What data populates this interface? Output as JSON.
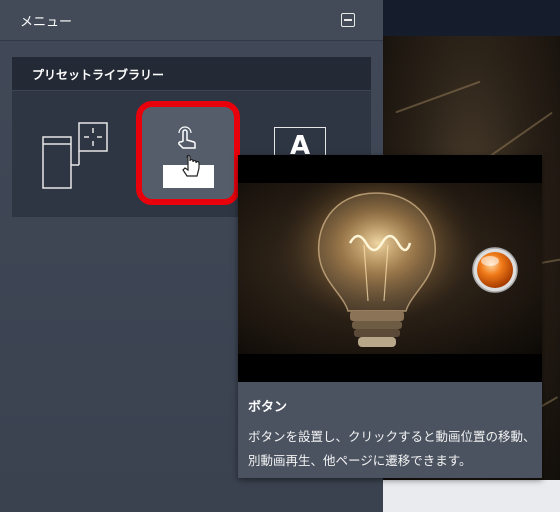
{
  "menu": {
    "title": "メニュー",
    "collapse_icon": "minus-box-icon"
  },
  "preset_library": {
    "title": "プリセットライブラリー",
    "tiles": [
      {
        "icon": "layout-frame-icon",
        "selected": false
      },
      {
        "icon": "button-click-icon",
        "selected": true
      },
      {
        "icon": "text-letter-icon",
        "selected": false
      }
    ],
    "tile3_letter": "A"
  },
  "tooltip": {
    "title": "ボタン",
    "description": "ボタンを設置し、クリックすると動画位置の移動、別動画再生、他ページに遷移できます。"
  },
  "colors": {
    "selection_ring": "#e8000b",
    "accent_orange": "#f07a18"
  }
}
